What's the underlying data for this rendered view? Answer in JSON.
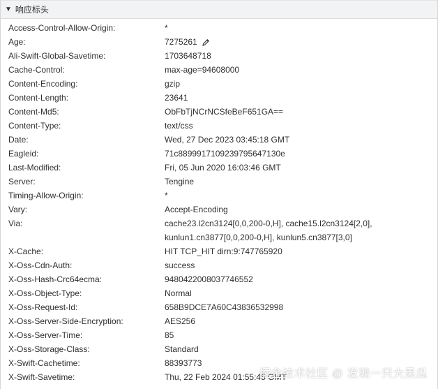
{
  "section": {
    "title": "响应标头",
    "caret": "▼"
  },
  "headers": [
    {
      "name": "Access-Control-Allow-Origin:",
      "value": "*"
    },
    {
      "name": "Age:",
      "value": "7275261"
    },
    {
      "name": "Ali-Swift-Global-Savetime:",
      "value": "1703648718"
    },
    {
      "name": "Cache-Control:",
      "value": "max-age=94608000"
    },
    {
      "name": "Content-Encoding:",
      "value": "gzip"
    },
    {
      "name": "Content-Length:",
      "value": "23641"
    },
    {
      "name": "Content-Md5:",
      "value": "ObFbTjNCrNCSfeBeF651GA=="
    },
    {
      "name": "Content-Type:",
      "value": "text/css"
    },
    {
      "name": "Date:",
      "value": "Wed, 27 Dec 2023 03:45:18 GMT"
    },
    {
      "name": "Eagleid:",
      "value": "71c8899917109239795647130e"
    },
    {
      "name": "Last-Modified:",
      "value": "Fri, 05 Jun 2020 16:03:46 GMT"
    },
    {
      "name": "Server:",
      "value": "Tengine"
    },
    {
      "name": "Timing-Allow-Origin:",
      "value": "*"
    },
    {
      "name": "Vary:",
      "value": "Accept-Encoding"
    },
    {
      "name": "Via:",
      "value_line1": "cache23.l2cn3124[0,0,200-0,H], cache15.l2cn3124[2,0],",
      "value_line2": "kunlun1.cn3877[0,0,200-0,H], kunlun5.cn3877[3,0]"
    },
    {
      "name": "X-Cache:",
      "value": "HIT TCP_HIT dirn:9:747765920"
    },
    {
      "name": "X-Oss-Cdn-Auth:",
      "value": "success"
    },
    {
      "name": "X-Oss-Hash-Crc64ecma:",
      "value": "9480422008037746552"
    },
    {
      "name": "X-Oss-Object-Type:",
      "value": "Normal"
    },
    {
      "name": "X-Oss-Request-Id:",
      "value": "658B9DCE7A60C43836532998"
    },
    {
      "name": "X-Oss-Server-Side-Encryption:",
      "value": "AES256"
    },
    {
      "name": "X-Oss-Server-Time:",
      "value": "85"
    },
    {
      "name": "X-Oss-Storage-Class:",
      "value": "Standard"
    },
    {
      "name": "X-Swift-Cachetime:",
      "value": "88393773"
    },
    {
      "name": "X-Swift-Savetime:",
      "value": "Thu, 22 Feb 2024 01:55:45 GMT"
    }
  ],
  "age_edit_icon": "pencil-icon",
  "watermark": "掘金技术社区 @ 发现一只大呆瓜"
}
